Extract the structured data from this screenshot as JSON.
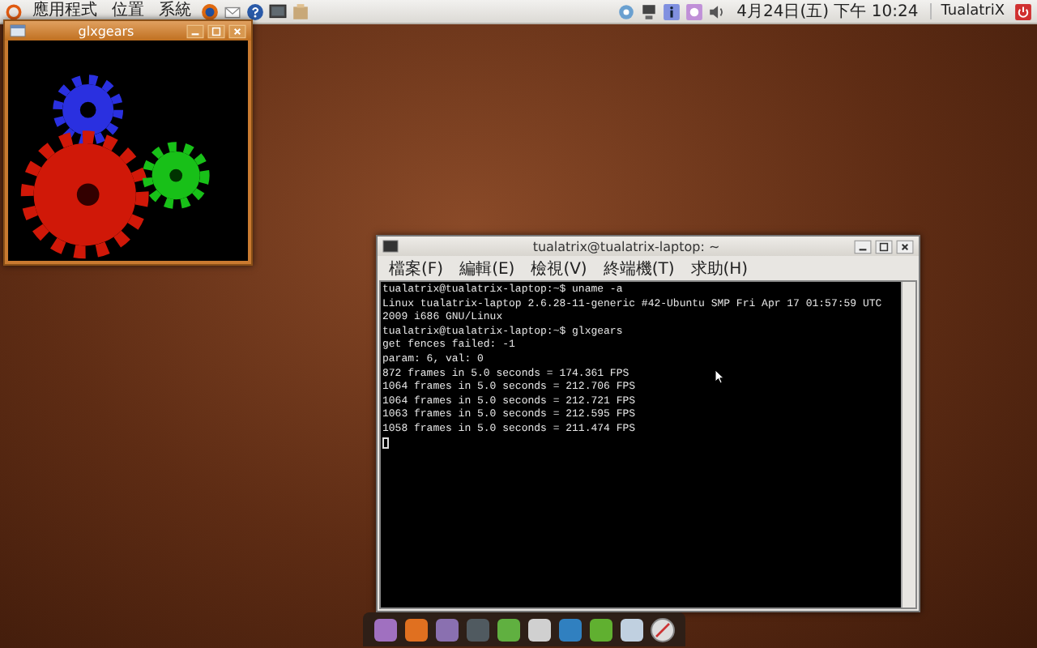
{
  "top_panel": {
    "menus": [
      "應用程式",
      "位置",
      "系統"
    ],
    "clock": "4月24日(五) 下午 10:24",
    "user": "TualatriX"
  },
  "glxgears_window": {
    "title": "glxgears"
  },
  "terminal_window": {
    "title": "tualatrix@tualatrix-laptop: ~",
    "menus": [
      "檔案(F)",
      "編輯(E)",
      "檢視(V)",
      "終端機(T)",
      "求助(H)"
    ],
    "lines": [
      "tualatrix@tualatrix-laptop:~$ uname -a",
      "Linux tualatrix-laptop 2.6.28-11-generic #42-Ubuntu SMP Fri Apr 17 01:57:59 UTC",
      "2009 i686 GNU/Linux",
      "tualatrix@tualatrix-laptop:~$ glxgears",
      "get fences failed: -1",
      "param: 6, val: 0",
      "872 frames in 5.0 seconds = 174.361 FPS",
      "1064 frames in 5.0 seconds = 212.706 FPS",
      "1064 frames in 5.0 seconds = 212.721 FPS",
      "1063 frames in 5.0 seconds = 212.595 FPS",
      "1058 frames in 5.0 seconds = 211.474 FPS"
    ]
  }
}
